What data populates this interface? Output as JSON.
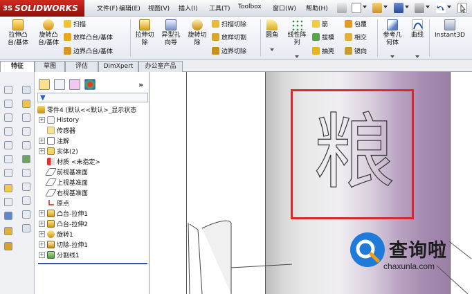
{
  "app": {
    "brand": "SOLIDWORKS",
    "brand_prefix": "3S"
  },
  "menu": [
    "文件(F)",
    "编辑(E)",
    "视图(V)",
    "插入(I)",
    "工具(T)",
    "Toolbox",
    "窗口(W)",
    "帮助(H)"
  ],
  "ribbon": {
    "big": [
      {
        "label1": "拉伸凸",
        "label2": "台/基体",
        "icon": "extrude-boss-icon"
      },
      {
        "label1": "旋转凸",
        "label2": "台/基体",
        "icon": "revolve-boss-icon"
      },
      {
        "label1": "拉伸切",
        "label2": "除",
        "icon": "extrude-cut-icon"
      },
      {
        "label1": "异型孔",
        "label2": "向导",
        "icon": "hole-wizard-icon"
      },
      {
        "label1": "旋转切",
        "label2": "除",
        "icon": "revolve-cut-icon"
      },
      {
        "label1": "圆角",
        "label2": "",
        "icon": "fillet-icon"
      },
      {
        "label1": "线性阵",
        "label2": "列",
        "icon": "linear-pattern-icon"
      },
      {
        "label1": "参考几",
        "label2": "何体",
        "icon": "reference-geometry-icon"
      },
      {
        "label1": "曲线",
        "label2": "",
        "icon": "curves-icon"
      },
      {
        "label1": "Instant3D",
        "label2": "",
        "icon": "instant3d-icon"
      }
    ],
    "small_boss": [
      "扫描",
      "放样凸台/基体",
      "边界凸台/基体"
    ],
    "small_cut": [
      "扫描切除",
      "放样切割",
      "边界切除"
    ],
    "small_feat": [
      "筋",
      "拔模",
      "抽壳"
    ],
    "small_feat2": [
      "包覆",
      "相交",
      "镜向"
    ]
  },
  "tabs": [
    "特征",
    "草图",
    "评估",
    "DimXpert",
    "办公室产品"
  ],
  "tree": {
    "root": "零件4 (默认<<默认>_显示状态",
    "items": [
      {
        "label": "History",
        "expand": "+"
      },
      {
        "label": "传感器",
        "expand": ""
      },
      {
        "label": "注解",
        "expand": "+"
      },
      {
        "label": "实体(2)",
        "expand": "+"
      },
      {
        "label": "材质 <未指定>",
        "expand": ""
      },
      {
        "label": "前视基准面",
        "expand": ""
      },
      {
        "label": "上视基准面",
        "expand": ""
      },
      {
        "label": "右视基准面",
        "expand": ""
      },
      {
        "label": "原点",
        "expand": ""
      },
      {
        "label": "凸台-拉伸1",
        "expand": "+"
      },
      {
        "label": "凸台-拉伸2",
        "expand": "+"
      },
      {
        "label": "旋转1",
        "expand": "+"
      },
      {
        "label": "切除-拉伸1",
        "expand": "+"
      },
      {
        "label": "分割线1",
        "expand": "+"
      }
    ]
  },
  "graphics": {
    "engraved_text": "粮"
  },
  "watermark": {
    "title": "查询啦",
    "url": "chaxunla.com"
  },
  "colors": {
    "highlight_box": "#d8282c",
    "brand_red": "#c0211a",
    "watermark_blue": "#1f7ad8"
  }
}
